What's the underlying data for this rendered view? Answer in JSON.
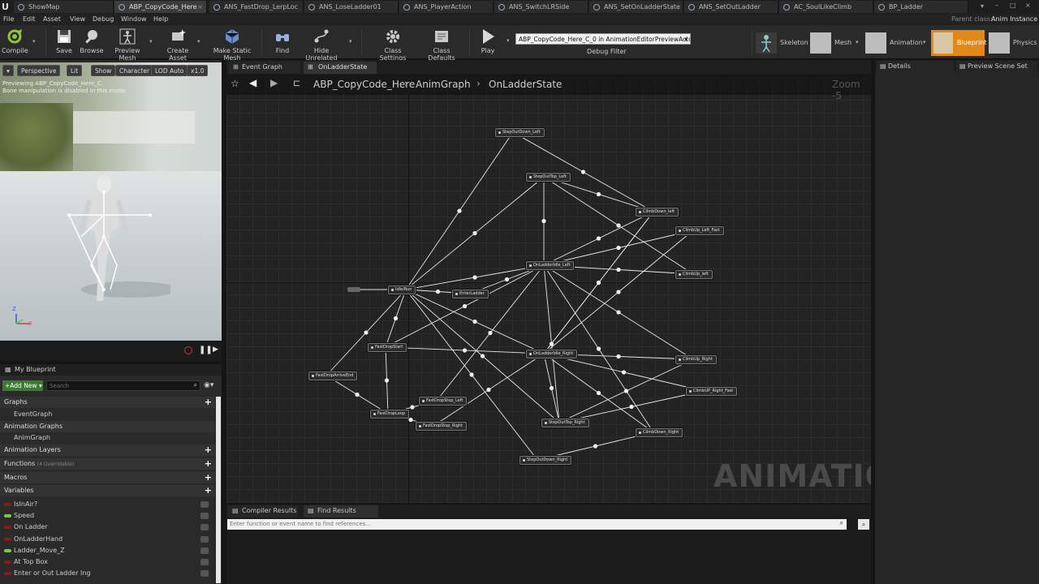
{
  "tabs": [
    {
      "label": "ShowMap",
      "active": false
    },
    {
      "label": "ABP_CopyCode_Here",
      "active": true
    },
    {
      "label": "ANS_FastDrop_LerpLoc",
      "active": false
    },
    {
      "label": "ANS_LoseLadder01",
      "active": false
    },
    {
      "label": "ANS_PlayerAction",
      "active": false
    },
    {
      "label": "ANS_SwitchLRSide",
      "active": false
    },
    {
      "label": "ANS_SetOnLadderState",
      "active": false
    },
    {
      "label": "ANS_SetOutLadder",
      "active": false
    },
    {
      "label": "AC_SoulLikeClimb",
      "active": false
    },
    {
      "label": "BP_Ladder",
      "active": false
    }
  ],
  "parent_class_label": "Parent class:",
  "parent_class_value": "Anim Instance",
  "menu": [
    "File",
    "Edit",
    "Asset",
    "View",
    "Debug",
    "Window",
    "Help"
  ],
  "toolbar": {
    "compile": "Compile",
    "save": "Save",
    "browse": "Browse",
    "preview_mesh": "Preview Mesh",
    "create_asset": "Create Asset",
    "make_static_mesh": "Make Static Mesh",
    "find": "Find",
    "hide_unrelated": "Hide Unrelated",
    "class_settings": "Class Settings",
    "class_defaults": "Class Defaults",
    "play": "Play",
    "debug_value": "ABP_CopyCode_Here_C_0 in AnimationEditorPreviewActor",
    "debug_filter": "Debug Filter",
    "modes": {
      "skeleton": "Skeleton",
      "mesh": "Mesh",
      "animation": "Animation",
      "blueprint": "Blueprint",
      "physics": "Physics"
    }
  },
  "viewport": {
    "perspective": "Perspective",
    "lit": "Lit",
    "show": "Show",
    "character": "Character",
    "lod": "LOD Auto",
    "speed": "x1.0",
    "msg1": "Previewing ABP_CopyCode_Here_C.",
    "msg2": "Bone manipulation is disabled in this mode.",
    "axis_z": "Z",
    "axis_x": "X"
  },
  "graph_tabs": {
    "event_graph": "Event Graph",
    "on_ladder_state": "OnLadderState"
  },
  "breadcrumb": [
    "ABP_CopyCode_Here",
    "AnimGraph",
    "OnLadderState"
  ],
  "zoom": "Zoom -5",
  "watermark": "ANIMATION",
  "nodes": [
    {
      "id": "StepOutDown_Left",
      "label": "StepOutDown_Left"
    },
    {
      "id": "StepOutTop_Left",
      "label": "StepOutTop_Left"
    },
    {
      "id": "ClimbDown_left",
      "label": "ClimbDown_left"
    },
    {
      "id": "ClimbUp_Left_Fast",
      "label": "ClimbUp_Left_Fast"
    },
    {
      "id": "OnLadderIdle_Left",
      "label": "OnLadderIdle_Left"
    },
    {
      "id": "ClimbUp_left",
      "label": "ClimbUp_left"
    },
    {
      "id": "IdleRun",
      "label": "Idle/Run"
    },
    {
      "id": "EnterLadder",
      "label": "EnterLadder"
    },
    {
      "id": "FastDropStart",
      "label": "FastDropStart"
    },
    {
      "id": "OnLadderIdle_Right",
      "label": "OnLadderIdle_Right"
    },
    {
      "id": "ClimbUp_Right",
      "label": "ClimbUp_Right"
    },
    {
      "id": "FastDropArriveEnd",
      "label": "FastDropArriveEnd"
    },
    {
      "id": "ClimbUP_Right_Fast",
      "label": "ClimbUP_Right_Fast"
    },
    {
      "id": "FastDropStop_Left",
      "label": "FastDropStop_Left"
    },
    {
      "id": "FastDropLoop",
      "label": "FastDropLoop"
    },
    {
      "id": "StepOutTop_Right",
      "label": "StepOutTop_Right"
    },
    {
      "id": "FastDropStop_Right",
      "label": "FastDropStop_Right"
    },
    {
      "id": "ClimbDown_Right",
      "label": "ClimbDown_Right"
    },
    {
      "id": "StepOutDown_Right",
      "label": "StepOutDown_Right"
    }
  ],
  "my_blueprint": {
    "title": "My Blueprint",
    "add_new": "Add New",
    "search_placeholder": "Search",
    "graphs": "Graphs",
    "event_graph": "EventGraph",
    "animation_graphs": "Animation Graphs",
    "anim_graph": "AnimGraph",
    "animation_layers": "Animation Layers",
    "functions": "Functions",
    "functions_note": "(4 Overridable)",
    "macros": "Macros",
    "variables": "Variables",
    "vars": [
      {
        "name": "IsInAir?",
        "color": "#8a1a1a"
      },
      {
        "name": "Speed",
        "color": "#7ec83a"
      },
      {
        "name": "On Ladder",
        "color": "#8a1a1a"
      },
      {
        "name": "OnLadderHand",
        "color": "#8a1a1a"
      },
      {
        "name": "Ladder_Move_Z",
        "color": "#7ec83a"
      },
      {
        "name": "At Top Box",
        "color": "#8a1a1a"
      },
      {
        "name": "Enter or Out Ladder Ing",
        "color": "#8a1a1a"
      }
    ]
  },
  "bottom": {
    "compiler_results": "Compiler Results",
    "find_results": "Find Results",
    "find_placeholder": "Enter function or event name to find references..."
  },
  "right": {
    "details": "Details",
    "preview_scene_set": "Preview Scene Set"
  }
}
